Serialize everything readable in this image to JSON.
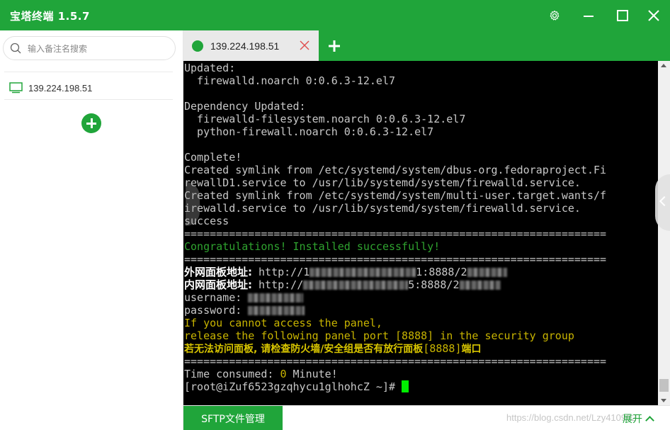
{
  "app": {
    "title": "宝塔终端 1.5.7"
  },
  "window_controls": {
    "settings_icon": "gear-icon",
    "minimize_icon": "minimize-icon",
    "maximize_icon": "maximize-icon",
    "close_icon": "close-icon"
  },
  "sidebar": {
    "search_placeholder": "输入备注名搜索",
    "servers": [
      {
        "label": "139.224.198.51",
        "icon": "monitor-icon"
      }
    ],
    "add_icon": "plus-icon"
  },
  "tabs": [
    {
      "label": "139.224.198.51",
      "status": "connected"
    }
  ],
  "terminal": {
    "lines": [
      {
        "text": "Updated:"
      },
      {
        "text": "  firewalld.noarch 0:0.6.3-12.el7"
      },
      {
        "text": ""
      },
      {
        "text": "Dependency Updated:"
      },
      {
        "text": "  firewalld-filesystem.noarch 0:0.6.3-12.el7"
      },
      {
        "text": "  python-firewall.noarch 0:0.6.3-12.el7"
      },
      {
        "text": ""
      },
      {
        "text": "Complete!"
      },
      {
        "text": "Created symlink from /etc/systemd/system/dbus-org.fedoraproject.Fi"
      },
      {
        "text": "rewallD1.service to /usr/lib/systemd/system/firewalld.service."
      },
      {
        "text": "Created symlink from /etc/systemd/system/multi-user.target.wants/f"
      },
      {
        "text": "irewalld.service to /usr/lib/systemd/system/firewalld.service."
      },
      {
        "text": "success"
      },
      {
        "text": "=================================================================="
      },
      {
        "text": "Congratulations! Installed successfully!"
      },
      {
        "text": "=================================================================="
      },
      {
        "label": "外网面板地址:",
        "url_prefix": " http://1",
        "url_suffix": "1:8888/2"
      },
      {
        "label": "内网面板地址:",
        "url_prefix": " http://",
        "url_suffix": "5:8888/2"
      },
      {
        "text": "username: "
      },
      {
        "text": "password: "
      },
      {
        "text": "If you cannot access the panel,"
      },
      {
        "text": "release the following panel port [8888] in the security group"
      },
      {
        "text_cn_a": "若无法访问面板, 请检查防火墙/安全组是否有放行面板",
        "text_cn_b": "[8888]",
        "text_cn_c": "端口"
      },
      {
        "text": "=================================================================="
      },
      {
        "text_a": "Time consumed: ",
        "text_b": "0",
        "text_c": " Minute!"
      },
      {
        "text": "[root@iZuf6523gzqhycu1glhohcZ ~]# "
      }
    ]
  },
  "bottom": {
    "sftp_label": "SFTP文件管理",
    "watermark": "https://blog.csdn.net/Lzy410992",
    "expand_label": "展开"
  },
  "colors": {
    "brand_green": "#20a53a",
    "terminal_bg": "#000000",
    "terminal_green": "#2fa32f",
    "terminal_yellow": "#c8b400",
    "cursor": "#00ee00"
  }
}
